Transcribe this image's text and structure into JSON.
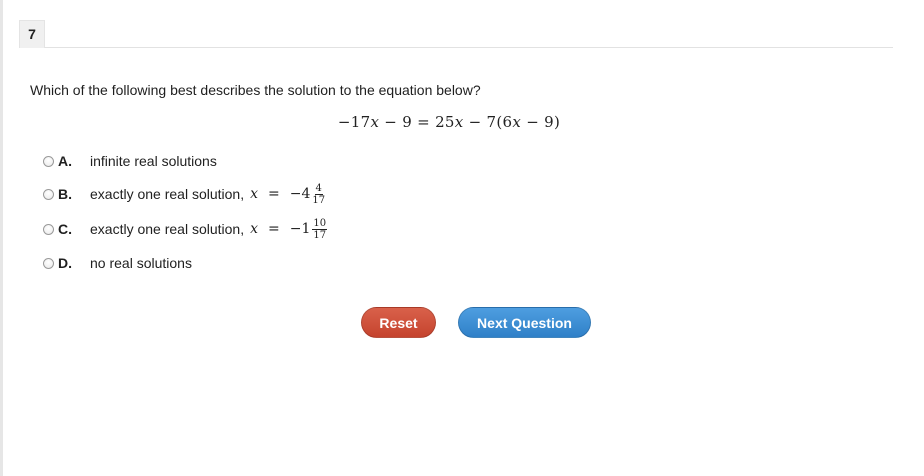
{
  "question": {
    "number": "7",
    "prompt": "Which of the following best describes the solution to the equation below?",
    "equation": {
      "lhs_coef": "−17",
      "lhs_var": "x",
      "lhs_rest": " − 9 = ",
      "rhs_coef": "25",
      "rhs_var": "x",
      "rhs_mid": " − 7(6",
      "rhs_var2": "x",
      "rhs_end": " − 9)"
    }
  },
  "choices": [
    {
      "letter": "A.",
      "text": "infinite real solutions"
    },
    {
      "letter": "B.",
      "text": "exactly one real solution,",
      "var": "x",
      "eq": "=",
      "whole": "−4",
      "num": "4",
      "den": "17"
    },
    {
      "letter": "C.",
      "text": "exactly one real solution,",
      "var": "x",
      "eq": "=",
      "whole": "−1",
      "num": "10",
      "den": "17"
    },
    {
      "letter": "D.",
      "text": "no real solutions"
    }
  ],
  "buttons": {
    "reset_label": "Reset",
    "next_label": "Next Question"
  },
  "colors": {
    "reset": "#cf513b",
    "next": "#3e8fd6"
  }
}
